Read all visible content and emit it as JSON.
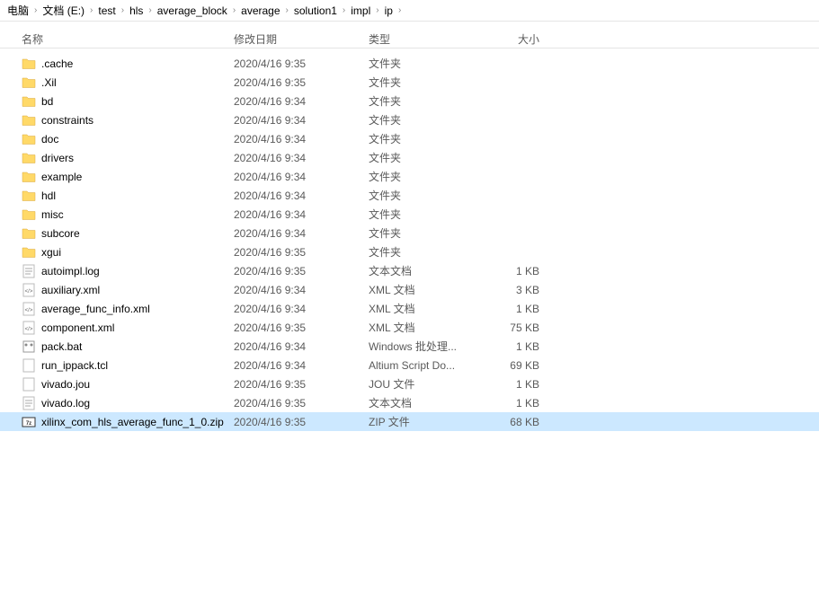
{
  "breadcrumb": [
    {
      "label": "电脑"
    },
    {
      "label": "文档 (E:)"
    },
    {
      "label": "test"
    },
    {
      "label": "hls"
    },
    {
      "label": "average_block"
    },
    {
      "label": "average"
    },
    {
      "label": "solution1"
    },
    {
      "label": "impl"
    },
    {
      "label": "ip"
    }
  ],
  "columns": {
    "name": "名称",
    "date": "修改日期",
    "type": "类型",
    "size": "大小"
  },
  "files": [
    {
      "icon": "folder",
      "name": ".cache",
      "date": "2020/4/16 9:35",
      "type": "文件夹",
      "size": ""
    },
    {
      "icon": "folder",
      "name": ".Xil",
      "date": "2020/4/16 9:35",
      "type": "文件夹",
      "size": ""
    },
    {
      "icon": "folder",
      "name": "bd",
      "date": "2020/4/16 9:34",
      "type": "文件夹",
      "size": ""
    },
    {
      "icon": "folder",
      "name": "constraints",
      "date": "2020/4/16 9:34",
      "type": "文件夹",
      "size": ""
    },
    {
      "icon": "folder",
      "name": "doc",
      "date": "2020/4/16 9:34",
      "type": "文件夹",
      "size": ""
    },
    {
      "icon": "folder",
      "name": "drivers",
      "date": "2020/4/16 9:34",
      "type": "文件夹",
      "size": ""
    },
    {
      "icon": "folder",
      "name": "example",
      "date": "2020/4/16 9:34",
      "type": "文件夹",
      "size": ""
    },
    {
      "icon": "folder",
      "name": "hdl",
      "date": "2020/4/16 9:34",
      "type": "文件夹",
      "size": ""
    },
    {
      "icon": "folder",
      "name": "misc",
      "date": "2020/4/16 9:34",
      "type": "文件夹",
      "size": ""
    },
    {
      "icon": "folder",
      "name": "subcore",
      "date": "2020/4/16 9:34",
      "type": "文件夹",
      "size": ""
    },
    {
      "icon": "folder",
      "name": "xgui",
      "date": "2020/4/16 9:35",
      "type": "文件夹",
      "size": ""
    },
    {
      "icon": "text",
      "name": "autoimpl.log",
      "date": "2020/4/16 9:35",
      "type": "文本文档",
      "size": "1 KB"
    },
    {
      "icon": "xml",
      "name": "auxiliary.xml",
      "date": "2020/4/16 9:34",
      "type": "XML 文档",
      "size": "3 KB"
    },
    {
      "icon": "xml",
      "name": "average_func_info.xml",
      "date": "2020/4/16 9:34",
      "type": "XML 文档",
      "size": "1 KB"
    },
    {
      "icon": "xml",
      "name": "component.xml",
      "date": "2020/4/16 9:35",
      "type": "XML 文档",
      "size": "75 KB"
    },
    {
      "icon": "bat",
      "name": "pack.bat",
      "date": "2020/4/16 9:34",
      "type": "Windows 批处理...",
      "size": "1 KB"
    },
    {
      "icon": "file",
      "name": "run_ippack.tcl",
      "date": "2020/4/16 9:34",
      "type": "Altium Script Do...",
      "size": "69 KB"
    },
    {
      "icon": "file",
      "name": "vivado.jou",
      "date": "2020/4/16 9:35",
      "type": "JOU 文件",
      "size": "1 KB"
    },
    {
      "icon": "text",
      "name": "vivado.log",
      "date": "2020/4/16 9:35",
      "type": "文本文档",
      "size": "1 KB"
    },
    {
      "icon": "zip",
      "name": "xilinx_com_hls_average_func_1_0.zip",
      "date": "2020/4/16 9:35",
      "type": "ZIP 文件",
      "size": "68 KB",
      "selected": true
    }
  ]
}
